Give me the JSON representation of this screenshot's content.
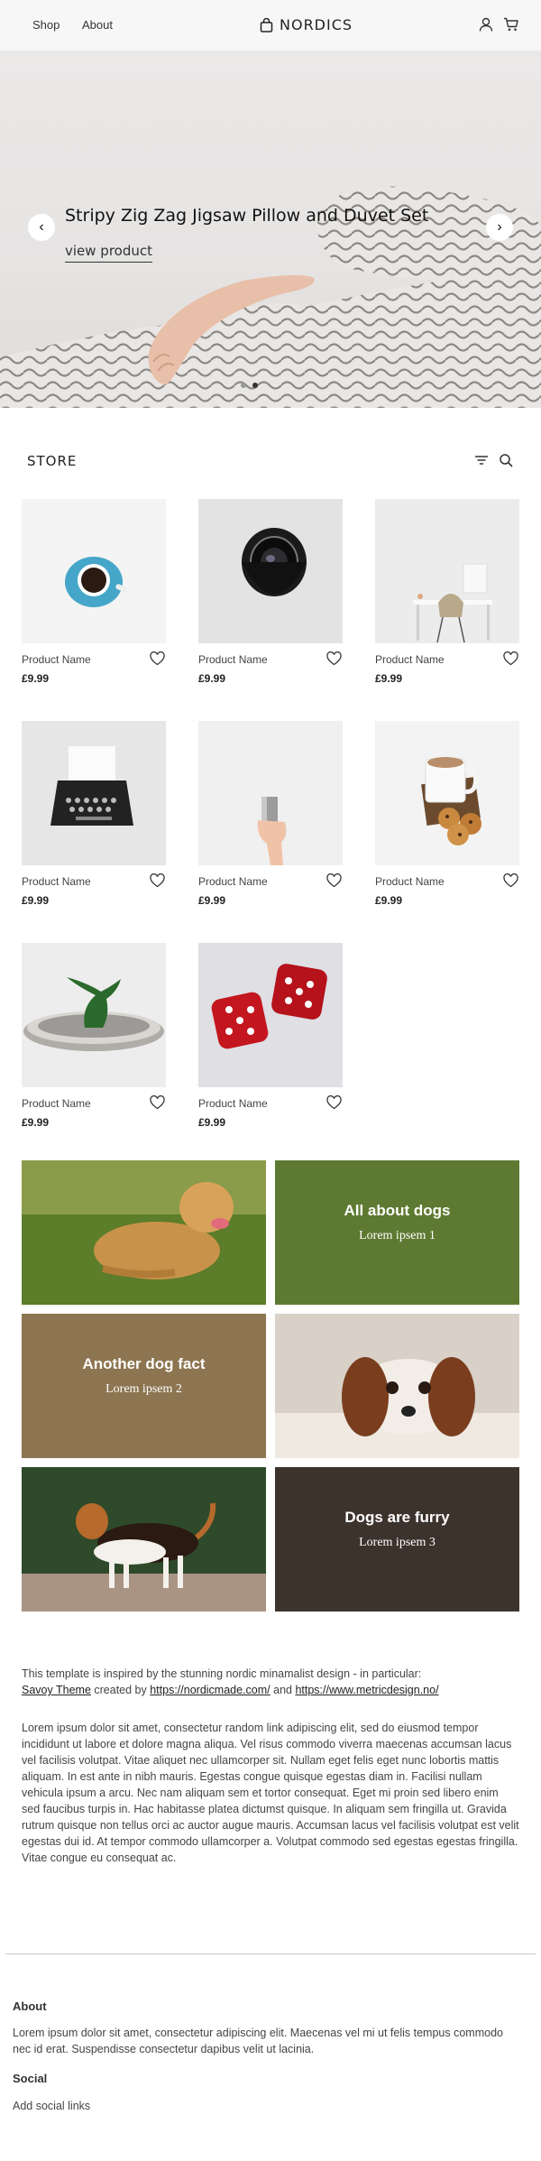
{
  "header": {
    "nav": [
      "Shop",
      "About"
    ],
    "brand": "NORDICS",
    "icons": [
      "shopping-bag-icon",
      "user-icon",
      "cart-icon"
    ]
  },
  "hero": {
    "title": "Stripy Zig Zag Jigsaw Pillow and Duvet Set",
    "link": "view product",
    "prev": "‹",
    "next": "›"
  },
  "store": {
    "title": "STORE",
    "products": [
      {
        "name": "Product Name",
        "price": "£9.99"
      },
      {
        "name": "Product Name",
        "price": "£9.99"
      },
      {
        "name": "Product Name",
        "price": "£9.99"
      },
      {
        "name": "Product Name",
        "price": "£9.99"
      },
      {
        "name": "Product Name",
        "price": "£9.99"
      },
      {
        "name": "Product Name",
        "price": "£9.99"
      },
      {
        "name": "Product Name",
        "price": "£9.99"
      },
      {
        "name": "Product Name",
        "price": "£9.99"
      }
    ]
  },
  "tiles": [
    {
      "title": "All about dogs",
      "sub": "Lorem ipsem 1",
      "color": "#5e7a32"
    },
    {
      "title": "Another dog fact",
      "sub": "Lorem ipsem 2",
      "color": "#8c7550"
    },
    {
      "title": "Dogs are furry",
      "sub": "Lorem ipsem 3",
      "color": "#3d332d"
    }
  ],
  "intro": {
    "text_before": "This template is inspired by the stunning nordic minamalist design - in particular:",
    "link1": "Savoy Theme",
    "text_mid1": " created by ",
    "link2": "https://nordicmade.com/",
    "text_mid2": " and ",
    "link3": "https://www.metricdesign.no/"
  },
  "lorem": "Lorem ipsum dolor sit amet, consectetur random link adipiscing elit, sed do eiusmod tempor incididunt ut labore et dolore magna aliqua. Vel risus commodo viverra maecenas accumsan lacus vel facilisis volutpat. Vitae aliquet nec ullamcorper sit. Nullam eget felis eget nunc lobortis mattis aliquam. In est ante in nibh mauris. Egestas congue quisque egestas diam in. Facilisi nullam vehicula ipsum a arcu. Nec nam aliquam sem et tortor consequat. Eget mi proin sed libero enim sed faucibus turpis in. Hac habitasse platea dictumst quisque. In aliquam sem fringilla ut. Gravida rutrum quisque non tellus orci ac auctor augue mauris. Accumsan lacus vel facilisis volutpat est velit egestas dui id. At tempor commodo ullamcorper a. Volutpat commodo sed egestas egestas fringilla. Vitae congue eu consequat ac.",
  "footer": {
    "about_title": "About",
    "about_text": "Lorem ipsum dolor sit amet, consectetur adipiscing elit. Maecenas vel mi ut felis tempus commodo nec id erat. Suspendisse consectetur dapibus velit ut lacinia.",
    "social_title": "Social",
    "social_text": "Add social links"
  }
}
